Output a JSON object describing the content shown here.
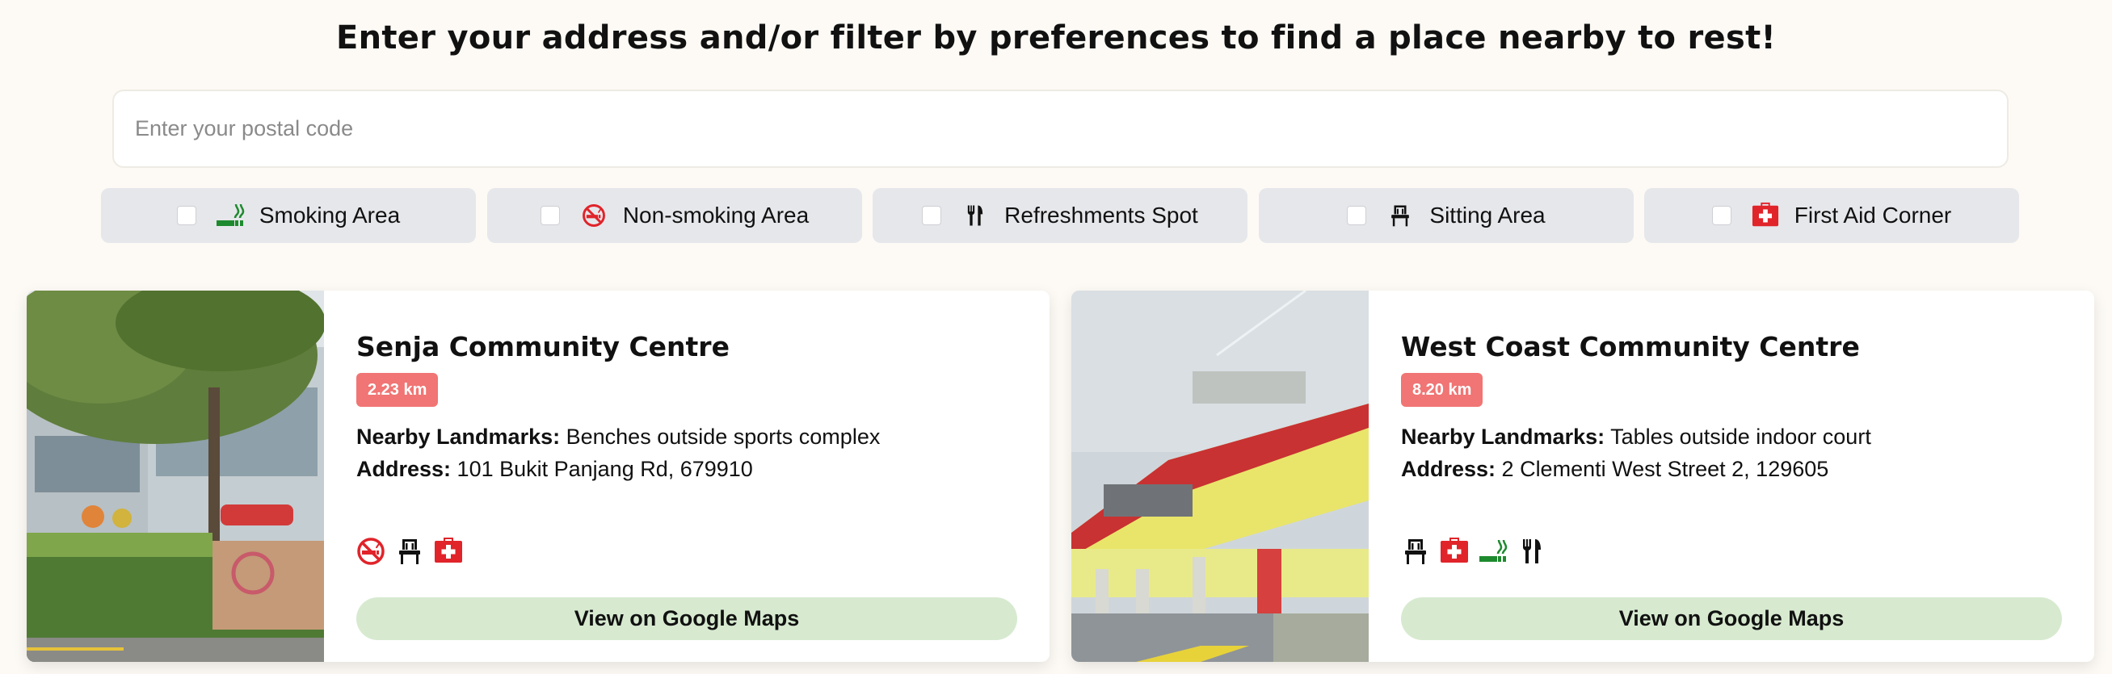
{
  "page": {
    "headline": "Enter your address and/or filter by preferences to find a place nearby to rest!"
  },
  "search": {
    "placeholder": "Enter your postal code",
    "value": ""
  },
  "filters": [
    {
      "label": "Smoking Area",
      "icon": "smoking-icon",
      "checked": false
    },
    {
      "label": "Non-smoking Area",
      "icon": "no-smoking-icon",
      "checked": false
    },
    {
      "label": "Refreshments Spot",
      "icon": "fork-knife-icon",
      "checked": false
    },
    {
      "label": "Sitting Area",
      "icon": "chair-icon",
      "checked": false
    },
    {
      "label": "First Aid Corner",
      "icon": "first-aid-icon",
      "checked": false
    }
  ],
  "results": [
    {
      "name": "Senja Community Centre",
      "distance": "2.23 km",
      "landmarks_label": "Nearby Landmarks:",
      "landmarks": "Benches outside sports complex",
      "address_label": "Address:",
      "address": "101 Bukit Panjang Rd, 679910",
      "amenities": [
        "no-smoking-icon",
        "chair-icon",
        "first-aid-icon"
      ],
      "button": "View on Google Maps",
      "photo": "photo-senja-community-centre"
    },
    {
      "name": "West Coast Community Centre",
      "distance": "8.20 km",
      "landmarks_label": "Nearby Landmarks:",
      "landmarks": "Tables outside indoor court",
      "address_label": "Address:",
      "address": "2 Clementi West Street 2, 129605",
      "amenities": [
        "chair-icon",
        "first-aid-icon",
        "smoking-icon",
        "fork-knife-icon"
      ],
      "button": "View on Google Maps",
      "photo": "photo-west-coast-community-centre"
    }
  ],
  "colors": {
    "background": "#fdfaf5",
    "filter_bg": "#e6e7eb",
    "distance_badge": "#f07574",
    "maps_button": "#d7ead0",
    "smoking_green": "#1e8a2e",
    "red": "#e0242a"
  }
}
